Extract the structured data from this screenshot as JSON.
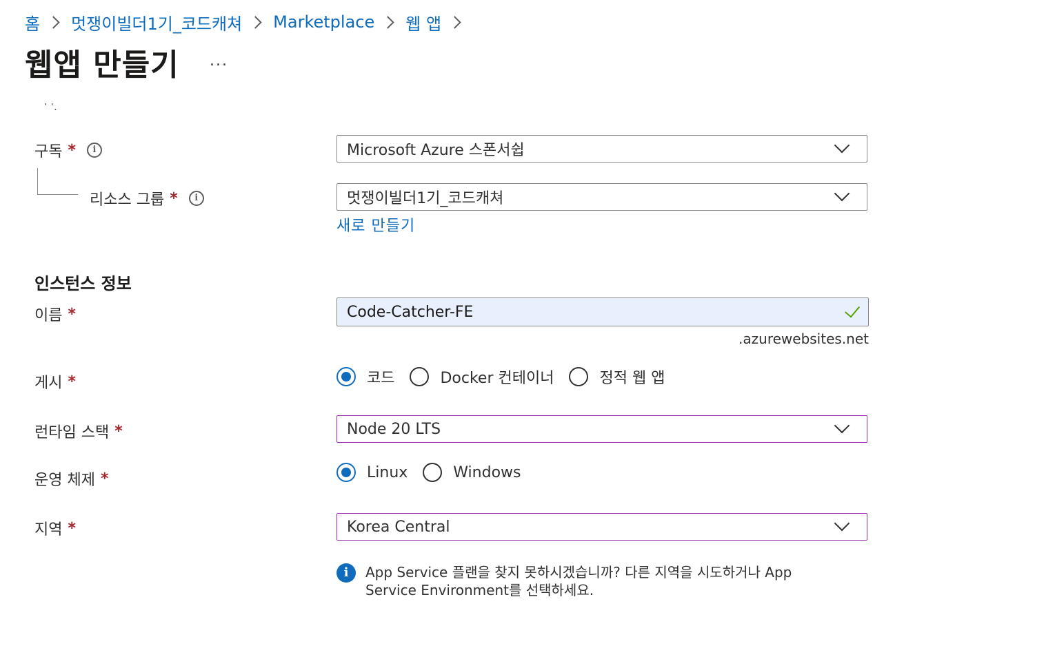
{
  "breadcrumb": {
    "items": [
      "홈",
      "멋쟁이빌더1기_코드캐쳐",
      "Marketplace",
      "웹 앱"
    ]
  },
  "page": {
    "title": "웹앱 만들기",
    "more": "...",
    "cut_text": "' '."
  },
  "subscription": {
    "label": "구독",
    "value": "Microsoft Azure 스폰서쉽"
  },
  "resource_group": {
    "label": "리소스 그룹",
    "value": "멋쟁이빌더1기_코드캐쳐",
    "create_new": "새로 만들기"
  },
  "instance": {
    "section_title": "인스턴스 정보",
    "name_label": "이름",
    "name_value": "Code-Catcher-FE",
    "name_suffix": ".azurewebsites.net"
  },
  "publish": {
    "label": "게시",
    "options": [
      "코드",
      "Docker 컨테이너",
      "정적 웹 앱"
    ],
    "selected": 0
  },
  "runtime": {
    "label": "런타임 스택",
    "value": "Node 20 LTS"
  },
  "os": {
    "label": "운영 체제",
    "options": [
      "Linux",
      "Windows"
    ],
    "selected": 0
  },
  "region": {
    "label": "지역",
    "value": "Korea Central",
    "info": "App Service 플랜을 찾지 못하시겠습니까? 다른 지역을 시도하거나 App Service Environment를 선택하세요."
  },
  "required_mark": "*",
  "colors": {
    "link": "#0f6cbd",
    "required": "#a4262c",
    "touched_border": "#9a2cb0",
    "valid": "#57a300",
    "autofill_bg": "#e8f0fe"
  }
}
